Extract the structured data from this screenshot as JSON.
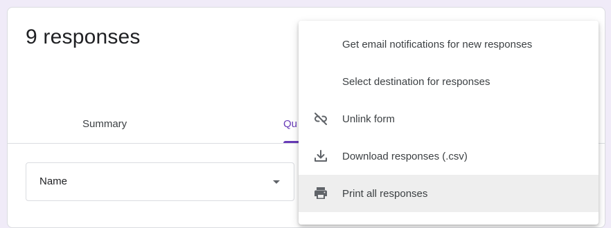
{
  "header": {
    "title": "9 responses"
  },
  "tabs": [
    {
      "label": "Summary"
    },
    {
      "label": "Qu"
    }
  ],
  "question_select": {
    "value": "Name"
  },
  "menu": {
    "items": [
      {
        "label": "Get email notifications for new responses",
        "icon": ""
      },
      {
        "label": "Select destination for responses",
        "icon": ""
      },
      {
        "label": "Unlink form",
        "icon": "unlink-icon"
      },
      {
        "label": "Download responses (.csv)",
        "icon": "download-icon"
      },
      {
        "label": "Print all responses",
        "icon": "print-icon",
        "highlighted": true
      }
    ]
  },
  "colors": {
    "accent": "#673ab7",
    "background": "#f0ebf8",
    "menu_highlight": "#eeeeee"
  }
}
